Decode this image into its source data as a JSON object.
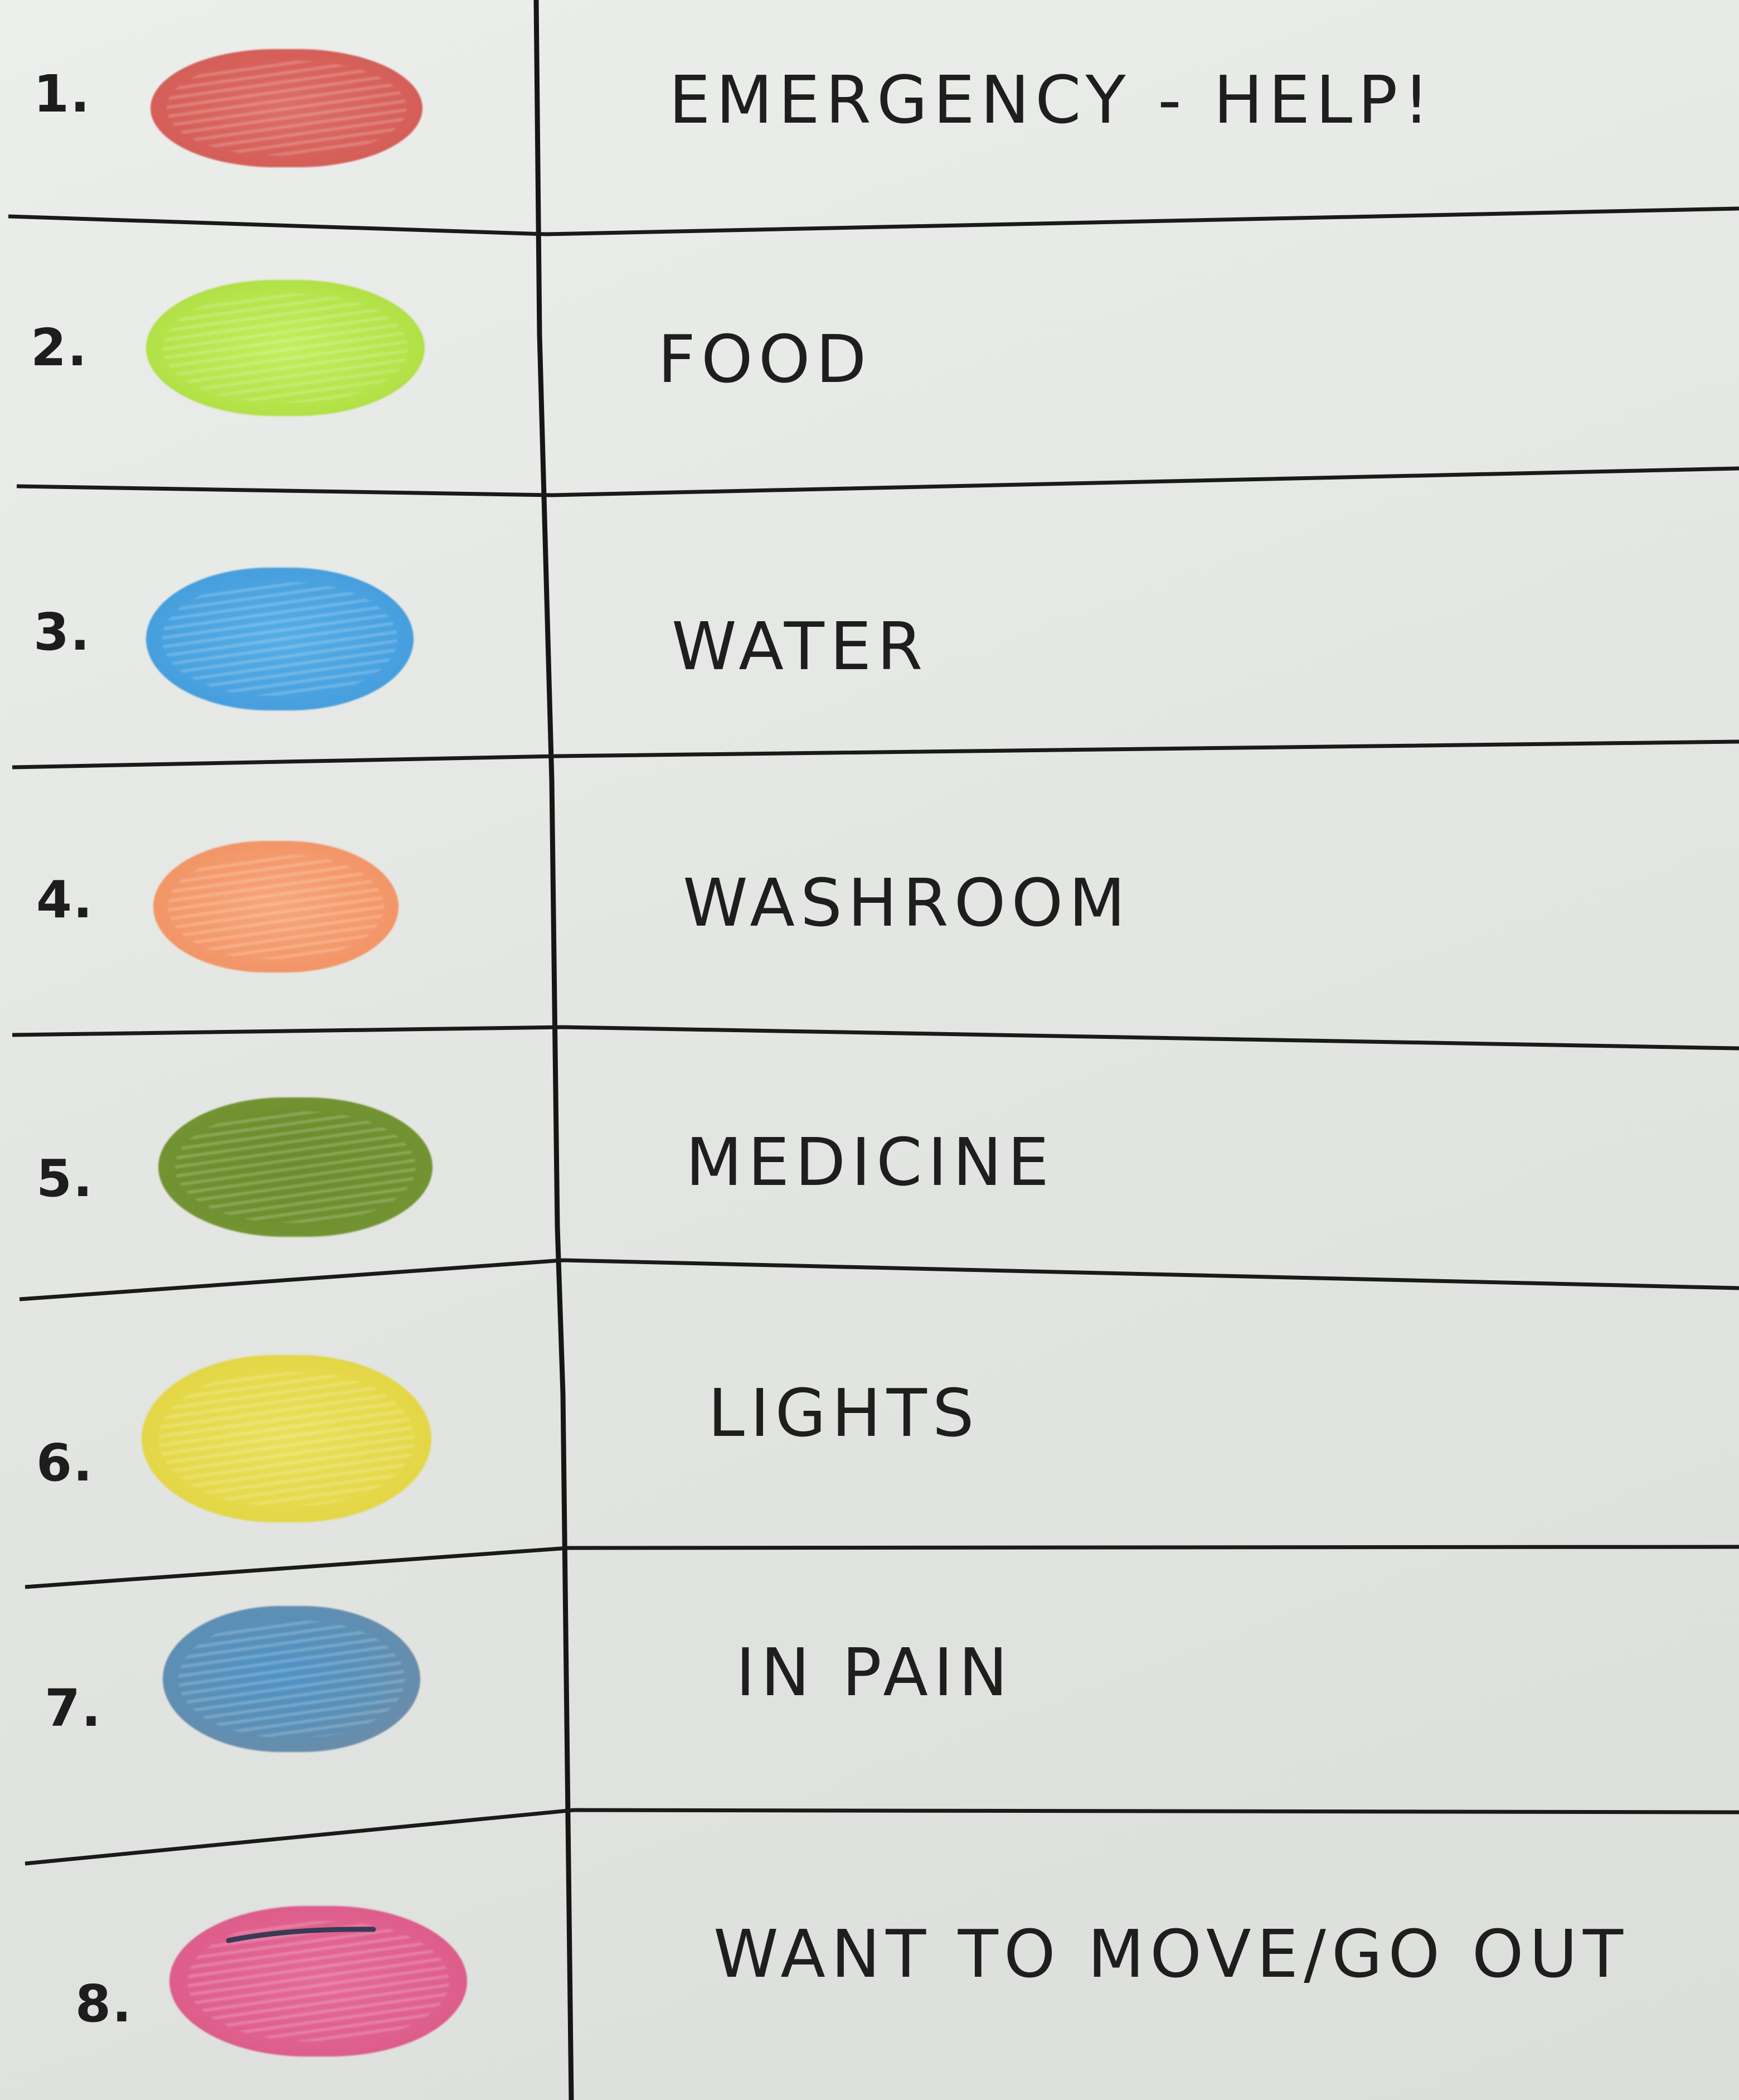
{
  "sheet": {
    "rows": [
      {
        "number": "1.",
        "label": "EMERGENCY - HELP!",
        "color": "#d9665c",
        "color_name": "red"
      },
      {
        "number": "2.",
        "label": "FOOD",
        "color": "#b6e64a",
        "color_name": "light-green"
      },
      {
        "number": "3.",
        "label": "WATER",
        "color": "#4aa3e0",
        "color_name": "blue"
      },
      {
        "number": "4.",
        "label": "WASHROOM",
        "color": "#f49a6c",
        "color_name": "orange"
      },
      {
        "number": "5.",
        "label": "MEDICINE",
        "color": "#6d8f2e",
        "color_name": "olive-green"
      },
      {
        "number": "6.",
        "label": "LIGHTS",
        "color": "#e6dc4a",
        "color_name": "yellow"
      },
      {
        "number": "7.",
        "label": "IN PAIN",
        "color": "#5d8fb4",
        "color_name": "grey-blue"
      },
      {
        "number": "8.",
        "label": "WANT TO MOVE/GO OUT",
        "color": "#e0608f",
        "color_name": "pink"
      }
    ]
  }
}
